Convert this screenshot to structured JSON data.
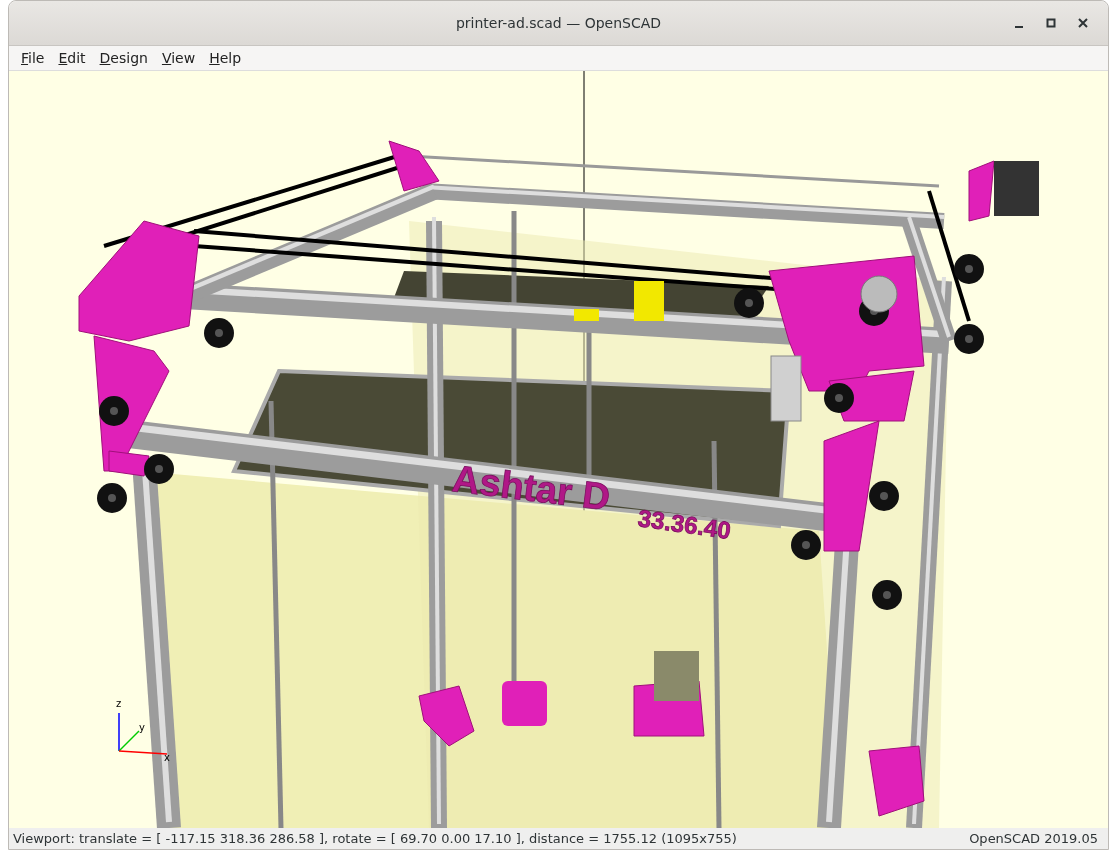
{
  "window": {
    "title": "printer-ad.scad — OpenSCAD"
  },
  "menu": [
    {
      "label": "File"
    },
    {
      "label": "Edit"
    },
    {
      "label": "Design"
    },
    {
      "label": "View"
    },
    {
      "label": "Help"
    }
  ],
  "viewport": {
    "model_text": [
      {
        "text": "Ashtar D",
        "kind": "large"
      },
      {
        "text": "33.36.40",
        "kind": "small"
      }
    ],
    "axes": [
      {
        "label": "z"
      },
      {
        "label": "y"
      },
      {
        "label": "x"
      }
    ]
  },
  "status_bar": {
    "viewport_info": "Viewport: translate = [ -117.15 318.36 286.58 ], rotate = [ 69.70 0.00 17.10 ], distance = 1755.12 (1095x755)",
    "version": "OpenSCAD 2019.05"
  }
}
